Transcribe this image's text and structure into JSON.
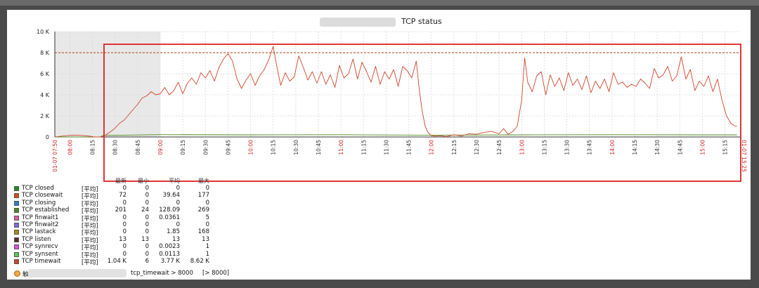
{
  "chart_data": {
    "type": "line",
    "title": "TCP status",
    "ylim": [
      0,
      10000
    ],
    "y_ticks": [
      "0",
      "2 K",
      "4 K",
      "6 K",
      "8 K",
      "10 K"
    ],
    "x_start_label": "01-07 07:50",
    "x_end_label": "01-07 15:25",
    "x_ticks": [
      {
        "label": "08:00",
        "min": 0,
        "red": true
      },
      {
        "label": "08:15",
        "min": 15,
        "red": false
      },
      {
        "label": "08:30",
        "min": 30,
        "red": false
      },
      {
        "label": "08:45",
        "min": 45,
        "red": false
      },
      {
        "label": "09:00",
        "min": 60,
        "red": true
      },
      {
        "label": "09:15",
        "min": 75,
        "red": false
      },
      {
        "label": "09:30",
        "min": 90,
        "red": false
      },
      {
        "label": "09:45",
        "min": 105,
        "red": false
      },
      {
        "label": "10:00",
        "min": 120,
        "red": true
      },
      {
        "label": "10:15",
        "min": 135,
        "red": false
      },
      {
        "label": "10:30",
        "min": 150,
        "red": false
      },
      {
        "label": "10:45",
        "min": 165,
        "red": false
      },
      {
        "label": "11:00",
        "min": 180,
        "red": true
      },
      {
        "label": "11:15",
        "min": 195,
        "red": false
      },
      {
        "label": "11:30",
        "min": 210,
        "red": false
      },
      {
        "label": "11:45",
        "min": 225,
        "red": false
      },
      {
        "label": "12:00",
        "min": 240,
        "red": true
      },
      {
        "label": "12:15",
        "min": 255,
        "red": false
      },
      {
        "label": "12:30",
        "min": 270,
        "red": false
      },
      {
        "label": "12:45",
        "min": 285,
        "red": false
      },
      {
        "label": "13:00",
        "min": 300,
        "red": true
      },
      {
        "label": "13:15",
        "min": 315,
        "red": false
      },
      {
        "label": "13:30",
        "min": 330,
        "red": false
      },
      {
        "label": "13:45",
        "min": 345,
        "red": false
      },
      {
        "label": "14:00",
        "min": 360,
        "red": true
      },
      {
        "label": "14:15",
        "min": 375,
        "red": false
      },
      {
        "label": "14:30",
        "min": 390,
        "red": false
      },
      {
        "label": "14:45",
        "min": 405,
        "red": false
      },
      {
        "label": "15:00",
        "min": 420,
        "red": true
      },
      {
        "label": "15:15",
        "min": 435,
        "red": false
      }
    ],
    "threshold": {
      "value": 8000,
      "color": "#b04010"
    },
    "series": [
      {
        "name": "TCP timewait",
        "color": "#d2452a",
        "points": [
          [
            -10,
            0
          ],
          [
            -8,
            30
          ],
          [
            -5,
            90
          ],
          [
            -2,
            130
          ],
          [
            0,
            160
          ],
          [
            3,
            180
          ],
          [
            6,
            160
          ],
          [
            9,
            140
          ],
          [
            12,
            100
          ],
          [
            14,
            60
          ],
          [
            16,
            0
          ],
          [
            20,
            0
          ],
          [
            22,
            50
          ],
          [
            25,
            300
          ],
          [
            28,
            600
          ],
          [
            30,
            850
          ],
          [
            33,
            1300
          ],
          [
            36,
            1600
          ],
          [
            39,
            2100
          ],
          [
            42,
            2600
          ],
          [
            45,
            3100
          ],
          [
            48,
            3700
          ],
          [
            51,
            3900
          ],
          [
            54,
            4300
          ],
          [
            57,
            4000
          ],
          [
            60,
            4100
          ],
          [
            63,
            4700
          ],
          [
            66,
            4000
          ],
          [
            69,
            4400
          ],
          [
            72,
            5200
          ],
          [
            75,
            4100
          ],
          [
            78,
            5100
          ],
          [
            81,
            5600
          ],
          [
            84,
            5000
          ],
          [
            87,
            6100
          ],
          [
            90,
            5600
          ],
          [
            93,
            6300
          ],
          [
            96,
            5300
          ],
          [
            99,
            6600
          ],
          [
            102,
            7400
          ],
          [
            105,
            7900
          ],
          [
            108,
            7200
          ],
          [
            111,
            5500
          ],
          [
            114,
            4600
          ],
          [
            117,
            5400
          ],
          [
            120,
            6000
          ],
          [
            123,
            4900
          ],
          [
            126,
            5800
          ],
          [
            129,
            6400
          ],
          [
            132,
            7300
          ],
          [
            135,
            8600
          ],
          [
            137,
            7000
          ],
          [
            140,
            4900
          ],
          [
            143,
            6100
          ],
          [
            146,
            5300
          ],
          [
            149,
            5700
          ],
          [
            152,
            7700
          ],
          [
            155,
            6600
          ],
          [
            158,
            5400
          ],
          [
            161,
            6200
          ],
          [
            164,
            5100
          ],
          [
            167,
            6200
          ],
          [
            170,
            5000
          ],
          [
            173,
            5900
          ],
          [
            176,
            4700
          ],
          [
            179,
            6800
          ],
          [
            182,
            5600
          ],
          [
            185,
            6000
          ],
          [
            188,
            7400
          ],
          [
            191,
            5500
          ],
          [
            194,
            7100
          ],
          [
            197,
            6200
          ],
          [
            200,
            5200
          ],
          [
            203,
            6700
          ],
          [
            206,
            5000
          ],
          [
            209,
            6200
          ],
          [
            212,
            5500
          ],
          [
            215,
            6400
          ],
          [
            218,
            4800
          ],
          [
            221,
            6700
          ],
          [
            224,
            6300
          ],
          [
            227,
            5600
          ],
          [
            230,
            7200
          ],
          [
            232,
            4500
          ],
          [
            234,
            2400
          ],
          [
            236,
            1000
          ],
          [
            238,
            400
          ],
          [
            240,
            120
          ],
          [
            243,
            80
          ],
          [
            246,
            110
          ],
          [
            250,
            40
          ],
          [
            255,
            210
          ],
          [
            260,
            90
          ],
          [
            265,
            300
          ],
          [
            270,
            260
          ],
          [
            275,
            430
          ],
          [
            280,
            540
          ],
          [
            285,
            300
          ],
          [
            288,
            800
          ],
          [
            291,
            250
          ],
          [
            294,
            500
          ],
          [
            297,
            1000
          ],
          [
            300,
            3500
          ],
          [
            302,
            7500
          ],
          [
            304,
            5200
          ],
          [
            307,
            4300
          ],
          [
            310,
            5800
          ],
          [
            313,
            6200
          ],
          [
            316,
            4000
          ],
          [
            319,
            5900
          ],
          [
            322,
            4800
          ],
          [
            325,
            5600
          ],
          [
            328,
            4400
          ],
          [
            331,
            6100
          ],
          [
            334,
            4900
          ],
          [
            337,
            5500
          ],
          [
            340,
            4500
          ],
          [
            343,
            5800
          ],
          [
            346,
            4200
          ],
          [
            349,
            5300
          ],
          [
            352,
            4600
          ],
          [
            355,
            5500
          ],
          [
            358,
            4300
          ],
          [
            361,
            6100
          ],
          [
            364,
            5000
          ],
          [
            367,
            5200
          ],
          [
            370,
            4700
          ],
          [
            373,
            5000
          ],
          [
            376,
            4800
          ],
          [
            379,
            5500
          ],
          [
            382,
            5100
          ],
          [
            385,
            4600
          ],
          [
            388,
            6500
          ],
          [
            391,
            5600
          ],
          [
            394,
            5900
          ],
          [
            397,
            6700
          ],
          [
            400,
            5300
          ],
          [
            403,
            5800
          ],
          [
            406,
            7600
          ],
          [
            409,
            5500
          ],
          [
            412,
            6400
          ],
          [
            415,
            4400
          ],
          [
            418,
            5300
          ],
          [
            421,
            4800
          ],
          [
            424,
            5800
          ],
          [
            427,
            4300
          ],
          [
            430,
            5500
          ],
          [
            433,
            3500
          ],
          [
            436,
            2000
          ],
          [
            439,
            1300
          ],
          [
            441,
            1100
          ],
          [
            443,
            1000
          ]
        ]
      },
      {
        "name": "TCP established",
        "color": "#4d8a22",
        "points": [
          [
            -10,
            0
          ],
          [
            20,
            0
          ],
          [
            22,
            150
          ],
          [
            60,
            220
          ],
          [
            120,
            200
          ],
          [
            180,
            210
          ],
          [
            240,
            170
          ],
          [
            300,
            200
          ],
          [
            360,
            210
          ],
          [
            420,
            200
          ],
          [
            443,
            200
          ]
        ]
      }
    ]
  },
  "legend": {
    "headers": [
      "最新",
      "最小",
      "平均",
      "最大"
    ],
    "rows": [
      {
        "name": "TCP closed",
        "fn": "[平均]",
        "last": "0",
        "min": "0",
        "avg": "0",
        "max": "0",
        "color": "#1e8f1e"
      },
      {
        "name": "TCP closewait",
        "fn": "[平均]",
        "last": "72",
        "min": "0",
        "avg": "39.64",
        "max": "177",
        "color": "#d05010"
      },
      {
        "name": "TCP closing",
        "fn": "[平均]",
        "last": "0",
        "min": "0",
        "avg": "0",
        "max": "0",
        "color": "#2a7fd0"
      },
      {
        "name": "TCP established",
        "fn": "[平均]",
        "last": "201",
        "min": "24",
        "avg": "128.09",
        "max": "269",
        "color": "#4d8a22"
      },
      {
        "name": "TCP finwait1",
        "fn": "[平均]",
        "last": "0",
        "min": "0",
        "avg": "0.0361",
        "max": "5",
        "color": "#e25aa8"
      },
      {
        "name": "TCP finwait2",
        "fn": "[平均]",
        "last": "0",
        "min": "0",
        "avg": "0",
        "max": "0",
        "color": "#7a6fd8"
      },
      {
        "name": "TCP lastack",
        "fn": "[平均]",
        "last": "0",
        "min": "0",
        "avg": "1.85",
        "max": "168",
        "color": "#a88a1a"
      },
      {
        "name": "TCP listen",
        "fn": "[平均]",
        "last": "13",
        "min": "13",
        "avg": "13",
        "max": "13",
        "color": "#5a2a2a"
      },
      {
        "name": "TCP synrecv",
        "fn": "[平均]",
        "last": "0",
        "min": "0",
        "avg": "0.0023",
        "max": "1",
        "color": "#e050e0"
      },
      {
        "name": "TCP synsent",
        "fn": "[平均]",
        "last": "0",
        "min": "0",
        "avg": "0.0113",
        "max": "1",
        "color": "#5ac85a"
      },
      {
        "name": "TCP timewait",
        "fn": "[平均]",
        "last": "1.04 K",
        "min": "6",
        "avg": "3.77 K",
        "max": "8.62 K",
        "color": "#d2452a"
      }
    ]
  },
  "trigger": {
    "prefix": "触",
    "expression": "tcp_timewait > 8000",
    "value": "[> 8000]"
  }
}
